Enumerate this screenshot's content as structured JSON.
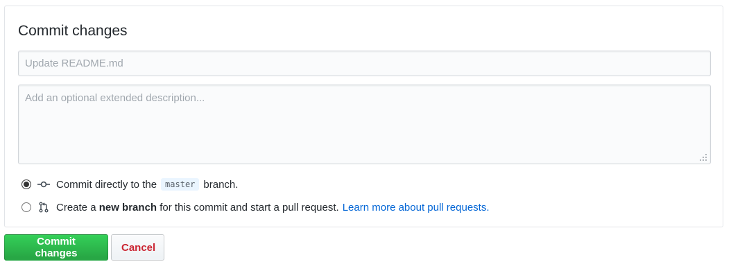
{
  "panel": {
    "title": "Commit changes",
    "summary": {
      "value": "",
      "placeholder": "Update README.md"
    },
    "description": {
      "value": "",
      "placeholder": "Add an optional extended description..."
    }
  },
  "options": {
    "direct": {
      "checked": true,
      "text_before": "Commit directly to the",
      "branch": "master",
      "text_after": "branch."
    },
    "new_branch": {
      "checked": false,
      "text_before": "Create a",
      "bold": "new branch",
      "text_after": "for this commit and start a pull request.",
      "link": "Learn more about pull requests."
    }
  },
  "buttons": {
    "commit": "Commit changes",
    "cancel": "Cancel"
  },
  "colors": {
    "commit_button": "#28a745",
    "cancel_text": "#cb2431",
    "link": "#0366d6",
    "branch_pill_bg": "#eaf5ff"
  },
  "icons": {
    "commit": "git-commit-icon",
    "pull_request": "git-pull-request-icon"
  }
}
